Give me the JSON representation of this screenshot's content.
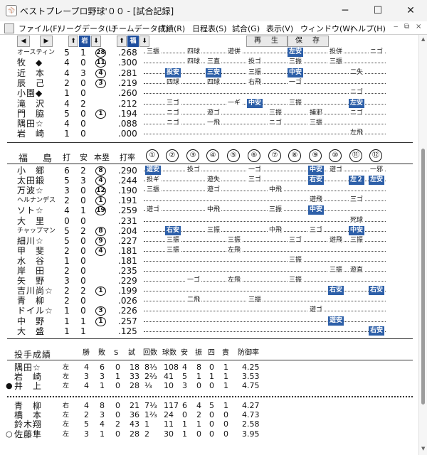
{
  "window": {
    "title": "ベストプレープロ野球'００ - [試合記録]",
    "app_icon": "baseball-app-icon",
    "minimize": "─",
    "maximize": "☐",
    "close": "✕"
  },
  "menu": {
    "items": [
      "ファイル(F)",
      "リーグデータ(L)",
      "チームデータ(T)",
      "成績(R)",
      "日程表(S)",
      "試合(G)",
      "表示(V)",
      "ウィンドウ(W)",
      "ヘルプ(H)"
    ],
    "mdi": [
      "‒",
      "⧉",
      "×"
    ]
  },
  "toolbar": {
    "prev": "◀",
    "next": "▶",
    "away_up": "⬆",
    "away_team": "岩",
    "away_down": "⬇",
    "home_up": "⬆",
    "home_team": "福",
    "home_down": "⬇",
    "replay": "再　生",
    "save": "保　存"
  },
  "away_tail": [
    {
      "name": "オースティン",
      "ab": "5",
      "h": "1",
      "hr": "28",
      "avg": ".268",
      "res": [
        {
          "i": 1,
          "t": "三振"
        },
        {
          "i": 3,
          "t": "四球"
        },
        {
          "i": 5,
          "t": "遊併"
        },
        {
          "i": 8,
          "t": "左安",
          "hit": true
        },
        {
          "i": 10,
          "t": "投併"
        },
        {
          "i": 12,
          "t": "ニゴ"
        }
      ]
    },
    {
      "name": "牧　◆",
      "ab": "4",
      "h": "0",
      "hr": "11",
      "avg": ".300",
      "res": [
        {
          "i": 3,
          "t": "四球"
        },
        {
          "i": 4,
          "t": "三直"
        },
        {
          "i": 6,
          "t": "投ゴ"
        },
        {
          "i": 8,
          "t": "三振"
        },
        {
          "i": 10,
          "t": "三振"
        }
      ]
    },
    {
      "name": "近　本",
      "ab": "4",
      "h": "3",
      "hr": "4",
      "avg": ".281",
      "res": [
        {
          "i": 2,
          "t": "投安",
          "hit": true
        },
        {
          "i": 4,
          "t": "三安",
          "hit": true
        },
        {
          "i": 6,
          "t": "三振"
        },
        {
          "i": 8,
          "t": "中安",
          "hit": true
        },
        {
          "i": 11,
          "t": "二失"
        }
      ]
    },
    {
      "name": "辰　己",
      "ab": "2",
      "h": "0",
      "hr": "3",
      "avg": ".219",
      "res": [
        {
          "i": 2,
          "t": "四球"
        },
        {
          "i": 4,
          "t": "四球"
        },
        {
          "i": 6,
          "t": "右飛"
        },
        {
          "i": 8,
          "t": "一ゴ"
        }
      ]
    },
    {
      "name": "小園◆",
      "ab": "1",
      "h": "0",
      "hr": "",
      "avg": ".260",
      "res": [
        {
          "i": 11,
          "t": "ニゴ"
        }
      ]
    },
    {
      "name": "滝　沢",
      "ab": "4",
      "h": "2",
      "hr": "",
      "avg": ".212",
      "res": [
        {
          "i": 2,
          "t": "三ゴ"
        },
        {
          "i": 5,
          "t": "一ギ"
        },
        {
          "i": 6,
          "t": "中安",
          "hit": true
        },
        {
          "i": 8,
          "t": "三振"
        },
        {
          "i": 11,
          "t": "左安",
          "hit": true
        }
      ]
    },
    {
      "name": "門　脇",
      "ab": "5",
      "h": "0",
      "hr": "1",
      "avg": ".194",
      "res": [
        {
          "i": 2,
          "t": "ニゴ"
        },
        {
          "i": 4,
          "t": "遊ゴ"
        },
        {
          "i": 7,
          "t": "三振"
        },
        {
          "i": 9,
          "t": "捕邪"
        },
        {
          "i": 11,
          "t": "ニゴ"
        }
      ]
    },
    {
      "name": "隅田☆",
      "ab": "4",
      "h": "0",
      "hr": "",
      "avg": ".088",
      "res": [
        {
          "i": 2,
          "t": "ニゴ"
        },
        {
          "i": 4,
          "t": "一飛"
        },
        {
          "i": 7,
          "t": "ニゴ"
        },
        {
          "i": 9,
          "t": "三振"
        }
      ]
    },
    {
      "name": "岩　崎",
      "ab": "1",
      "h": "0",
      "hr": "",
      "avg": ".000",
      "res": [
        {
          "i": 11,
          "t": "左飛"
        }
      ]
    }
  ],
  "home": {
    "team": "福　島",
    "cols": {
      "ab": "打",
      "h": "安",
      "hr": "本塁",
      "avg": "打率"
    },
    "innings": [
      "①",
      "②",
      "③",
      "④",
      "⑤",
      "⑥",
      "⑦",
      "⑧",
      "⑨",
      "⑩",
      "⑪",
      "⑫"
    ],
    "players": [
      {
        "name": "小　郷",
        "ab": "6",
        "h": "2",
        "hr": "8",
        "avg": ".290",
        "res": [
          {
            "i": 1,
            "t": "遊安",
            "hit": true
          },
          {
            "i": 3,
            "t": "投ゴ"
          },
          {
            "i": 6,
            "t": "一ゴ"
          },
          {
            "i": 9,
            "t": "中安",
            "hit": true
          },
          {
            "i": 10,
            "t": "遊ゴ"
          },
          {
            "i": 12,
            "t": "一邪"
          }
        ]
      },
      {
        "name": "太田鍛",
        "ab": "5",
        "h": "3",
        "hr": "4",
        "avg": ".244",
        "res": [
          {
            "i": 1,
            "t": "投ギ"
          },
          {
            "i": 4,
            "t": "遊失"
          },
          {
            "i": 6,
            "t": "三ゴ"
          },
          {
            "i": 9,
            "t": "右安",
            "hit": true
          },
          {
            "i": 11,
            "t": "左２",
            "hit": true
          },
          {
            "i": 12,
            "t": "左安",
            "hit": true
          }
        ]
      },
      {
        "name": "万波☆",
        "ab": "3",
        "h": "0",
        "hr": "12",
        "avg": ".190",
        "res": [
          {
            "i": 1,
            "t": "三振"
          },
          {
            "i": 4,
            "t": "遊ゴ"
          },
          {
            "i": 7,
            "t": "中飛"
          }
        ]
      },
      {
        "name": "ヘルナンデス",
        "ab": "2",
        "h": "0",
        "hr": "1",
        "avg": ".191",
        "res": [
          {
            "i": 9,
            "t": "遊飛"
          },
          {
            "i": 11,
            "t": "三ゴ"
          }
        ]
      },
      {
        "name": "ソト☆",
        "ab": "4",
        "h": "1",
        "hr": "19",
        "avg": ".259",
        "res": [
          {
            "i": 1,
            "t": "遊ゴ"
          },
          {
            "i": 4,
            "t": "中飛"
          },
          {
            "i": 7,
            "t": "三振"
          },
          {
            "i": 9,
            "t": "中安",
            "hit": true
          }
        ]
      },
      {
        "name": "大　里",
        "ab": "0",
        "h": "0",
        "hr": "",
        "avg": ".231",
        "res": [
          {
            "i": 11,
            "t": "死球"
          }
        ]
      },
      {
        "name": "チャップマン",
        "ab": "5",
        "h": "2",
        "hr": "8",
        "avg": ".204",
        "res": [
          {
            "i": 2,
            "t": "右安",
            "hit": true
          },
          {
            "i": 4,
            "t": "三振"
          },
          {
            "i": 7,
            "t": "中飛"
          },
          {
            "i": 9,
            "t": "三ゴ"
          },
          {
            "i": 11,
            "t": "中安",
            "hit": true
          }
        ]
      },
      {
        "name": "細川☆",
        "ab": "5",
        "h": "0",
        "hr": "9",
        "avg": ".227",
        "res": [
          {
            "i": 2,
            "t": "三振"
          },
          {
            "i": 5,
            "t": "三振"
          },
          {
            "i": 8,
            "t": "三ゴ"
          },
          {
            "i": 10,
            "t": "遊飛"
          },
          {
            "i": 11,
            "t": "三振"
          }
        ]
      },
      {
        "name": "甲　斐",
        "ab": "2",
        "h": "0",
        "hr": "4",
        "avg": ".181",
        "res": [
          {
            "i": 2,
            "t": "三振"
          },
          {
            "i": 5,
            "t": "左飛"
          }
        ]
      },
      {
        "name": "水　谷",
        "ab": "1",
        "h": "0",
        "hr": "",
        "avg": ".181",
        "res": [
          {
            "i": 8,
            "t": "三振"
          }
        ]
      },
      {
        "name": "岸　田",
        "ab": "2",
        "h": "0",
        "hr": "",
        "avg": ".235",
        "res": [
          {
            "i": 10,
            "t": "三振"
          },
          {
            "i": 11,
            "t": "遊直"
          }
        ]
      },
      {
        "name": "矢　野",
        "ab": "3",
        "h": "0",
        "hr": "",
        "avg": ".229",
        "res": [
          {
            "i": 3,
            "t": "一ゴ"
          },
          {
            "i": 5,
            "t": "左飛"
          },
          {
            "i": 8,
            "t": "三振"
          }
        ]
      },
      {
        "name": "吉川尚☆",
        "ab": "2",
        "h": "2",
        "hr": "1",
        "avg": ".199",
        "res": [
          {
            "i": 10,
            "t": "右安",
            "hit": true
          },
          {
            "i": 12,
            "t": "右安",
            "hit": true
          }
        ]
      },
      {
        "name": "青　柳",
        "ab": "2",
        "h": "0",
        "hr": "",
        "avg": ".026",
        "res": [
          {
            "i": 3,
            "t": "二飛"
          },
          {
            "i": 6,
            "t": "三振"
          }
        ]
      },
      {
        "name": "ドイル☆",
        "ab": "1",
        "h": "0",
        "hr": "3",
        "avg": ".226",
        "res": [
          {
            "i": 9,
            "t": "遊ゴ"
          }
        ]
      },
      {
        "name": "中　野",
        "ab": "1",
        "h": "1",
        "hr": "1",
        "avg": ".257",
        "res": [
          {
            "i": 10,
            "t": "遊安",
            "hit": true
          }
        ]
      },
      {
        "name": "大　盛",
        "ab": "1",
        "h": "1",
        "hr": "",
        "avg": ".125",
        "res": [
          {
            "i": 12,
            "t": "右安",
            "hit": true
          }
        ]
      }
    ]
  },
  "pitching": {
    "title": "投手成績",
    "cols": [
      "勝",
      "敗",
      "S",
      "試",
      "回数",
      "球数",
      "安",
      "振",
      "四",
      "責",
      "防御率"
    ],
    "away": [
      {
        "mark": "",
        "name": "隅田☆",
        "hand": "左",
        "w": "4",
        "l": "6",
        "s": "0",
        "g": "18",
        "ip": "8⅓",
        "np": "108",
        "h": "4",
        "so": "8",
        "bb": "0",
        "er": "1",
        "era": "4.25"
      },
      {
        "mark": "",
        "name": "岩　崎",
        "hand": "左",
        "w": "3",
        "l": "3",
        "s": "1",
        "g": "33",
        "ip": "2⅔",
        "np": "41",
        "h": "5",
        "so": "1",
        "bb": "1",
        "er": "1",
        "era": "3.53"
      },
      {
        "mark": "●",
        "name": "井　上",
        "hand": "左",
        "w": "4",
        "l": "1",
        "s": "0",
        "g": "28",
        "ip": "⅓",
        "np": "10",
        "h": "3",
        "so": "0",
        "bb": "0",
        "er": "1",
        "era": "4.75"
      }
    ],
    "home": [
      {
        "mark": "",
        "name": "青　柳",
        "hand": "右",
        "w": "4",
        "l": "8",
        "s": "0",
        "g": "21",
        "ip": "7⅓",
        "np": "117",
        "h": "6",
        "so": "4",
        "bb": "5",
        "er": "1",
        "era": "4.27"
      },
      {
        "mark": "",
        "name": "橋　本",
        "hand": "左",
        "w": "2",
        "l": "3",
        "s": "0",
        "g": "36",
        "ip": "1⅔",
        "np": "24",
        "h": "0",
        "so": "2",
        "bb": "0",
        "er": "0",
        "era": "4.73"
      },
      {
        "mark": "",
        "name": "鈴木翔",
        "hand": "左",
        "w": "5",
        "l": "4",
        "s": "2",
        "g": "43",
        "ip": "1",
        "np": "11",
        "h": "1",
        "so": "1",
        "bb": "0",
        "er": "0",
        "era": "2.58"
      },
      {
        "mark": "○",
        "name": "佐藤隼",
        "hand": "左",
        "w": "3",
        "l": "1",
        "s": "0",
        "g": "28",
        "ip": "2",
        "np": "30",
        "h": "1",
        "so": "0",
        "bb": "0",
        "er": "0",
        "era": "3.95"
      }
    ]
  }
}
